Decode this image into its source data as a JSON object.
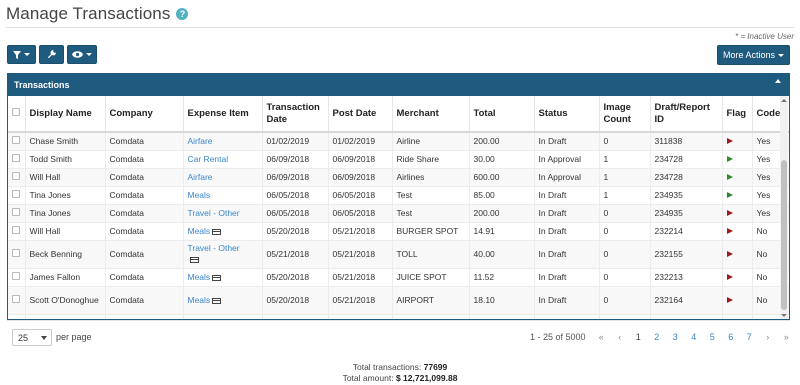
{
  "page": {
    "title": "Manage Transactions",
    "help_icon": "?",
    "inactive_note": "* = Inactive User"
  },
  "toolbar": {
    "filter_icon": "filter-icon",
    "settings_icon": "wrench-icon",
    "view_icon": "eye-icon",
    "more_actions_label": "More Actions"
  },
  "panel": {
    "title": "Transactions"
  },
  "table": {
    "columns": [
      "Display Name",
      "Company",
      "Expense Item",
      "Transaction Date",
      "Post Date",
      "Merchant",
      "Total",
      "Status",
      "Image Count",
      "Draft/Report ID",
      "Flag",
      "Coded"
    ],
    "rows": [
      {
        "name": "Chase Smith",
        "company": "Comdata",
        "expense": "Airfare",
        "card": false,
        "tdate": "01/02/2019",
        "pdate": "01/02/2019",
        "merchant": "Airline",
        "total": "200.00",
        "status": "In Draft",
        "images": "0",
        "report": "311838",
        "flag": "red",
        "coded": "Yes"
      },
      {
        "name": "Todd Smith",
        "company": "Comdata",
        "expense": "Car Rental",
        "card": false,
        "tdate": "06/09/2018",
        "pdate": "06/09/2018",
        "merchant": "Ride Share",
        "total": "30.00",
        "status": "In Approval",
        "images": "1",
        "report": "234728",
        "flag": "green",
        "coded": "Yes"
      },
      {
        "name": "Will Hall",
        "company": "Comdata",
        "expense": "Airfare",
        "card": false,
        "tdate": "06/09/2018",
        "pdate": "06/09/2018",
        "merchant": "Airlines",
        "total": "600.00",
        "status": "In Approval",
        "images": "1",
        "report": "234728",
        "flag": "green",
        "coded": "Yes"
      },
      {
        "name": "Tina Jones",
        "company": "Comdata",
        "expense": "Meals",
        "card": false,
        "tdate": "06/05/2018",
        "pdate": "06/05/2018",
        "merchant": "Test",
        "total": "85.00",
        "status": "In Draft",
        "images": "1",
        "report": "234935",
        "flag": "green",
        "coded": "Yes"
      },
      {
        "name": "Tina Jones",
        "company": "Comdata",
        "expense": "Travel - Other",
        "card": false,
        "tdate": "06/05/2018",
        "pdate": "06/05/2018",
        "merchant": "Test",
        "total": "200.00",
        "status": "In Draft",
        "images": "0",
        "report": "234935",
        "flag": "red",
        "coded": "Yes"
      },
      {
        "name": "Will Hall",
        "company": "Comdata",
        "expense": "Meals",
        "card": true,
        "tdate": "05/20/2018",
        "pdate": "05/21/2018",
        "merchant": "BURGER SPOT",
        "total": "14.91",
        "status": "In Draft",
        "images": "0",
        "report": "232214",
        "flag": "red",
        "coded": "No"
      },
      {
        "name": "Beck Benning",
        "company": "Comdata",
        "expense": "Travel - Other",
        "card": true,
        "tdate": "05/21/2018",
        "pdate": "05/21/2018",
        "merchant": "TOLL",
        "total": "40.00",
        "status": "In Draft",
        "images": "0",
        "report": "232155",
        "flag": "red",
        "coded": "No"
      },
      {
        "name": "James Fallon",
        "company": "Comdata",
        "expense": "Meals",
        "card": true,
        "tdate": "05/20/2018",
        "pdate": "05/21/2018",
        "merchant": "JUICE SPOT",
        "total": "11.52",
        "status": "In Draft",
        "images": "0",
        "report": "232213",
        "flag": "red",
        "coded": "No"
      },
      {
        "name": "Scott O'Donoghue",
        "company": "Comdata",
        "expense": "Meals",
        "card": true,
        "tdate": "05/20/2018",
        "pdate": "05/21/2018",
        "merchant": "AIRPORT",
        "total": "18.10",
        "status": "In Draft",
        "images": "0",
        "report": "232164",
        "flag": "red",
        "coded": "No"
      }
    ]
  },
  "pagination": {
    "per_page": "25",
    "per_page_label": "per page",
    "range": "1 - 25 of 5000",
    "first": "«",
    "prev": "‹",
    "pages": [
      "1",
      "2",
      "3",
      "4",
      "5",
      "6",
      "7"
    ],
    "active_page": "1",
    "next": "›",
    "last": "»"
  },
  "totals": {
    "transactions_label": "Total transactions:",
    "transactions_value": "77699",
    "amount_label": "Total amount:",
    "amount_value": "$ 12,721,099.88"
  },
  "colors": {
    "primary": "#1f5a7f",
    "link": "#3a86c8",
    "flag_red": "#9e1b1b",
    "flag_green": "#2f8a2f",
    "help": "#4fb1c2"
  }
}
